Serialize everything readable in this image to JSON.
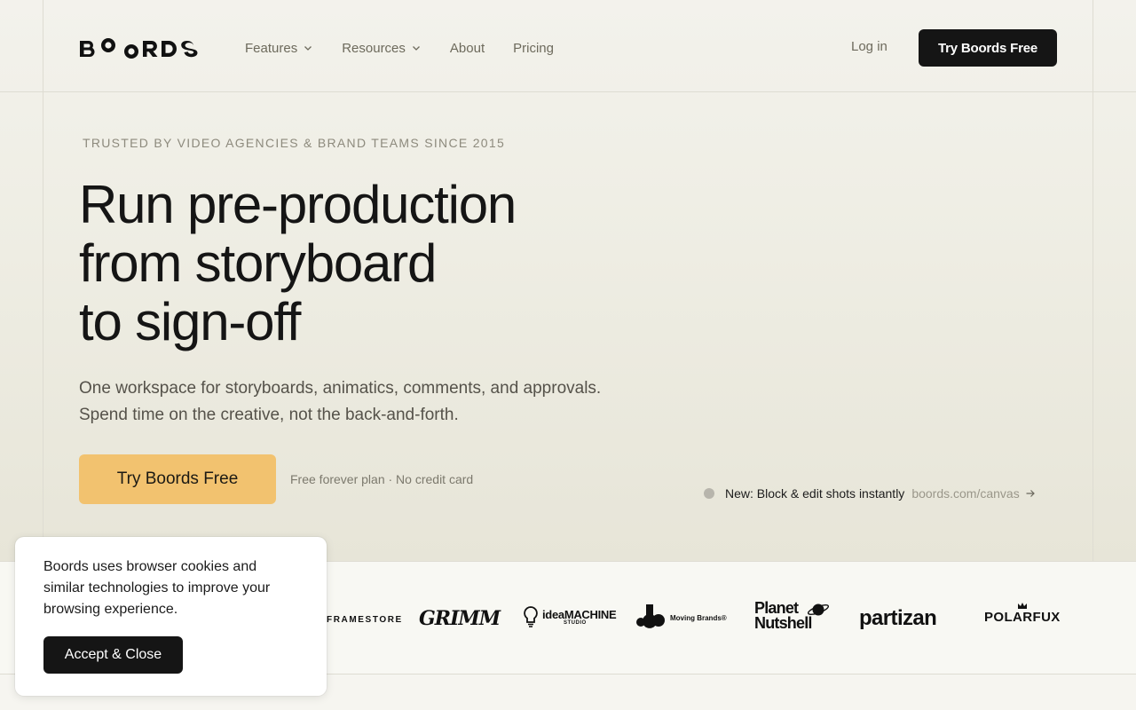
{
  "header": {
    "logo_text": "BOORDS",
    "nav": [
      {
        "label": "Features",
        "has_dropdown": true
      },
      {
        "label": "Resources",
        "has_dropdown": true
      },
      {
        "label": "About",
        "has_dropdown": false
      },
      {
        "label": "Pricing",
        "has_dropdown": false
      }
    ],
    "login_label": "Log in",
    "cta_label": "Try Boords Free"
  },
  "hero": {
    "eyebrow": "TRUSTED BY VIDEO AGENCIES & BRAND TEAMS SINCE 2015",
    "headline_lines": [
      "Run pre-production",
      "from storyboard",
      "to sign-off"
    ],
    "subtext_lines": [
      "One workspace for storyboards, animatics, comments, and approvals.",
      "Spend time on the creative, not the back-and-forth."
    ],
    "cta_label": "Try Boords Free",
    "cta_note": "Free forever plan · No credit card",
    "news": {
      "text": "New: Block & edit shots instantly",
      "link_label": "boords.com/canvas"
    }
  },
  "clients": {
    "framestore": "FRAMESTORE",
    "grimm": "GRIMM",
    "ideamachine": {
      "main": "ideaMACHINE",
      "sub": "STUDIO"
    },
    "moving_brands": "Moving Brands®",
    "planet_nutshell": [
      "Planet",
      "Nutshell"
    ],
    "partizan": "partizan",
    "polarfux": "POLARFUX"
  },
  "cookie": {
    "text": "Boords uses browser cookies and similar technologies to improve your browsing experience.",
    "button_label": "Accept & Close"
  },
  "colors": {
    "primary_button": "#151515",
    "accent_button": "#f2c26f",
    "background": "#f4f3ee"
  },
  "icons": [
    "chevron-down-icon",
    "arrow-right-icon",
    "status-dot-icon"
  ]
}
